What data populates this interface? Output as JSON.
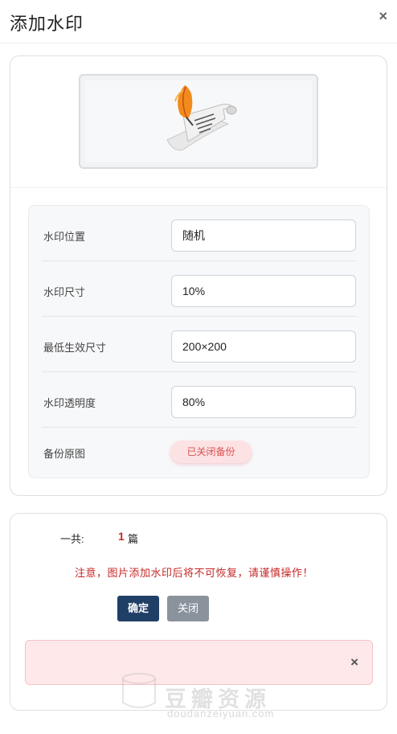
{
  "dialog": {
    "title": "添加水印",
    "close_glyph": "×"
  },
  "preview": {
    "icon": "quill-and-scroll-icon"
  },
  "settings": [
    {
      "label": "水印位置",
      "value": "随机"
    },
    {
      "label": "水印尺寸",
      "value": "10%"
    },
    {
      "label": "最低生效尺寸",
      "value": "200×200"
    },
    {
      "label": "水印透明度",
      "value": "80%"
    }
  ],
  "backup": {
    "label": "备份原图",
    "state_text": "已关闭备份"
  },
  "summary": {
    "total_label": "一共:",
    "total_count": "1",
    "total_unit": "篇",
    "warning": "注意，图片添加水印后将不可恢复，请谨慎操作！"
  },
  "buttons": {
    "confirm": "确定",
    "close": "关闭"
  },
  "alert": {
    "close_glyph": "×"
  },
  "watermark": {
    "text": "豆瓣资源",
    "sub": "doudanzeiyuan.com"
  },
  "colors": {
    "primary": "#1f3f66",
    "danger": "#c62828",
    "secondary": "#8a929c",
    "alert_bg": "#ffe8ea"
  }
}
